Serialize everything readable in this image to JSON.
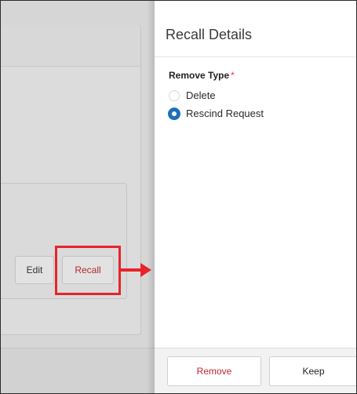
{
  "background": {
    "edit_label": "Edit",
    "recall_label": "Recall"
  },
  "panel": {
    "title": "Recall Details",
    "remove_type": {
      "label": "Remove Type",
      "required_mark": "*",
      "options": [
        {
          "label": "Delete",
          "selected": false
        },
        {
          "label": "Rescind Request",
          "selected": true
        }
      ]
    },
    "footer": {
      "remove_label": "Remove",
      "keep_label": "Keep"
    }
  },
  "colors": {
    "highlight": "#e8242a",
    "radio_selected": "#1e6fb8",
    "danger_text": "#c0262f"
  }
}
